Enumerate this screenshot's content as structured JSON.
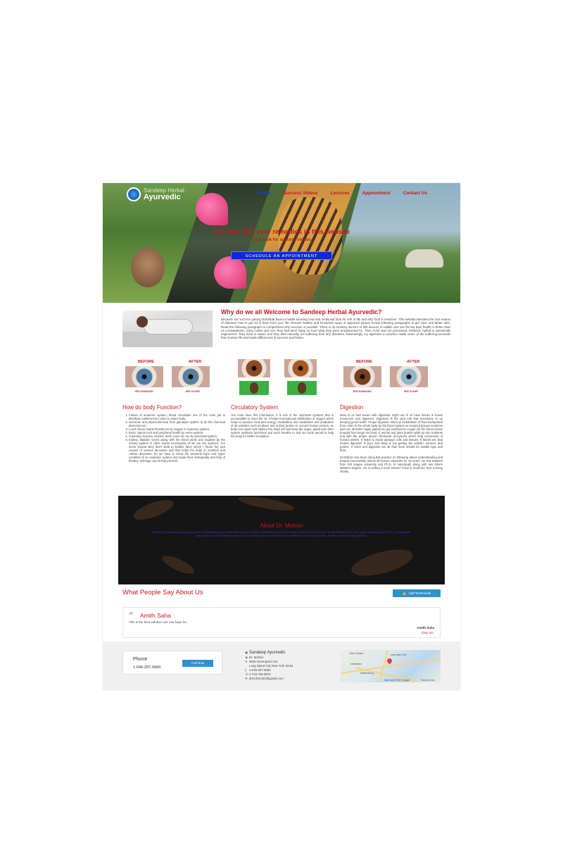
{
  "header": {
    "logo_line1": "Sandeep Herbal",
    "logo_line2": "Ayurvedic",
    "nav": [
      "Home",
      "Success Videos",
      "Lectures",
      "Appointment",
      "Contact Us"
    ]
  },
  "hero": {
    "title": "You may find your remedies in this website",
    "subtitle": "Start look for success videos",
    "button": "SCHEDULE AN APPOINTMENT"
  },
  "welcome": {
    "title": "Why do we all Welcome to Sandeep Herbal Ayurvedic?",
    "text": "Because our success getting individual back to health knowing food and medicinal food for rest of life and why food is medicine. This website Narrates the root reason of diseases how to get rid of them from your life, Remain healthy and Dr.Mohsin ways of approach please review following paragraphs to get clear and better idea. Read the following paragraph to comprehend why success is possible. There is no monkey doctors or fish doctors in wildlife and see life but their health is better than us comparatively. Since Adam and eve, they had been living on food what they were programmed for. Their Food was not processed, fertilized, hybrid or genetically engineered. They lived in nature and they died naturally not suffering from any diseases. Interestingly my approach in practice made some of the suffering,removals from human life and made differences in success and failure."
  },
  "eyes": {
    "before": "BEFORE",
    "after": "AFTER",
    "iris_damaged": "IRIS DAMAGED",
    "iris_clear": "IRIS CLEAR"
  },
  "columns": [
    {
      "title": "How do body Function?",
      "items": [
        "Failure of anatomic system, blood circulation one of the main job to distribute nutrition from colon to entire body.",
        "Hormone and physiochemical from glandular system to do the chemical phenomenon.",
        "Lunch Sinus hearts throats run by oxygen in repertory system.",
        "Brain, Spinal cord and peripheral health by nerve system.",
        "Voluntary muscles, tissues, teeth, bone etc run by structural system.",
        "Kidney, bladder, toxins along with the blood purify and regulate by the urinary system in other words mechanism of life are the systems. For some reason they don't work in bodies favor which I found the root causes of various deceases and that helps the body to manifest and collate deceases. So we have to know the anatomic-hypo and hyper condition of an anatomic system and repair them biologically and help of biotany. Iridology can do that job best."
      ]
    },
    {
      "title": "Circulatory System",
      "paragraphs": [
        "You must have this information, it is one of the important systems that is accountable to move life on. It helps Homogenous distribution of oxygen which helps to produce heat and energy, Oxidization and catabolism and anabolism of all activities such as plane and animal protein to convert human protein, so body can repair and replace the dead cell and keep the organ, gland and other system optimum functional and each breathe in and out cycle period to help the body for better circulation."
      ]
    },
    {
      "title": "Digestion",
      "paragraphs": [
        "Most of us had issues with digestion. Eight out of 10 have issues in bowel movement and digestion. Digestion is the vital role that necessary to up keeping good health. Proper digestion which is metabolism of food transported from colon to the whole body by the blood system as required tissues locations such as; Muscles organ glands etc get oxidized by oxygen by the blood vessel brought from lungs via heart. If animal and plant protein splits up into nutrients and with the proper physic chemicals (enzymes) which help conversion of human protein. It helps to repair damage cells and tissues. If stools are, that means digestion is poor and body is not getting the vitamin, mineral, and protein. If colon and digestion are ok than stool should be marble type and float.",
        "Dr.Mohsin Has been doing this practice on following above understanding and treated successfully almost all human elements for 25 years. He has Masters from IVE league university and Ph.D. in naturopath along with two others Masters Degree. He is writing a book named 'Food is medicine' that Coming shortly."
      ]
    }
  ],
  "about": {
    "title": "About Dr. Mohsin",
    "text": "Dr.Mohsin Has been doing this practice on following above understanding and treated successfully almost all human elements for 25 years. He has Masters from IVE league university and Ph.D. in naturopath along with two others Masters Degree. He is writing a book named 'Food is medicine' that Coming shortly. Please contact for appointment."
  },
  "testimonials": {
    "title": "What People Say About Us",
    "add_button": "Add Testimonial",
    "items": [
      {
        "name": "Amith Saha",
        "text": "This is the best solution one can hope for.",
        "author": "Amith Saha",
        "company": "Zaxy Inc."
      }
    ]
  },
  "footer": {
    "phone_label": "Phone",
    "phone_number": "1-646-287-0684",
    "call_button": "Call Now",
    "contact_title": "Sandeep Ayurvedic",
    "contact_name": "Dr. Mohsin",
    "address1": "3825 Greenpoint Ave",
    "address2": "Long Island City New York 11101",
    "phone1": "1-646-287-0684",
    "phone2": "1-718-706-8975",
    "email": "drmohsin203@gmail.com",
    "map_labels": [
      "Times Square",
      "Long Island City",
      "Manhattan",
      "Williamsburg",
      "Map data ©2017 Google",
      "Terms of Use"
    ]
  },
  "colors": {
    "accent_red": "#c8161d",
    "nav_active_blue": "#1e3bd6",
    "button_blue": "#2e92cf",
    "hero_button_blue": "#1128d8"
  }
}
